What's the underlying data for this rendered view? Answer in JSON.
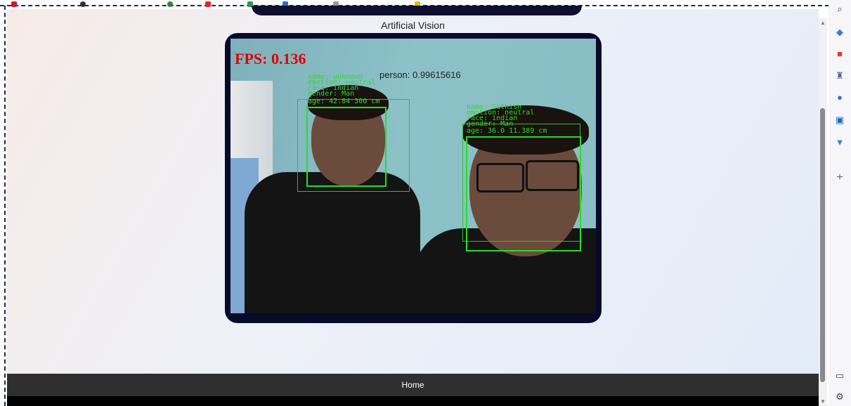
{
  "page": {
    "title": "Artificial Vision"
  },
  "video": {
    "fps_text": "FPS: 0.136",
    "person_text": "person: 0.99615616",
    "faces": [
      {
        "lines": [
          "name: unknown",
          "emotion: neutral",
          "race: indian",
          "gender: Man",
          "age: 42.84 300 cm"
        ]
      },
      {
        "lines": [
          "name: Sathish",
          "emotion: neutral",
          "race: indian",
          "gender: Man",
          "age: 36.0 11.389 cm"
        ]
      }
    ]
  },
  "footer": {
    "home_label": "Home"
  },
  "sidebar": {
    "icons": [
      "search-icon",
      "tag-icon",
      "toolbox-icon",
      "chess-icon",
      "copilot-icon",
      "outlook-icon",
      "send-icon",
      "add-icon",
      "panel-icon",
      "settings-icon"
    ]
  },
  "colors": {
    "frame": "#080a2c",
    "box": "#22e022",
    "fps": "#e00000"
  }
}
